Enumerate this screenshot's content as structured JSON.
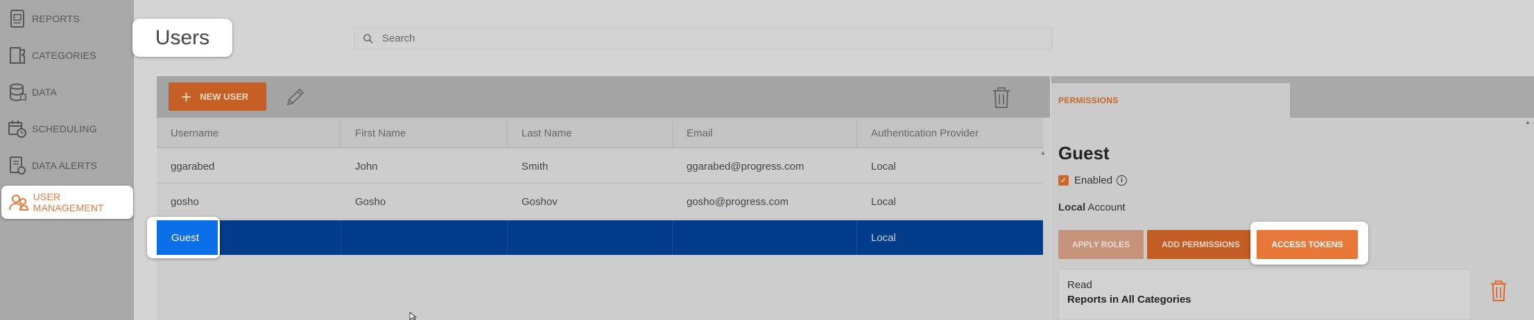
{
  "sidebar": {
    "items": [
      {
        "label": "REPORTS",
        "icon": "report-icon"
      },
      {
        "label": "CATEGORIES",
        "icon": "categories-icon"
      },
      {
        "label": "DATA",
        "icon": "database-icon"
      },
      {
        "label": "SCHEDULING",
        "icon": "scheduling-icon"
      },
      {
        "label": "DATA ALERTS",
        "icon": "alert-icon"
      },
      {
        "label": "USER MANAGEMENT",
        "icon": "users-icon",
        "active": true
      }
    ]
  },
  "page": {
    "title": "Users"
  },
  "search": {
    "placeholder": "Search",
    "icon": "search-icon"
  },
  "toolbar": {
    "new_user_label": "NEW USER",
    "new_user_icon": "plus-icon",
    "edit_icon": "pencil-icon",
    "delete_icon": "trash-icon"
  },
  "grid": {
    "columns": [
      "Username",
      "First Name",
      "Last Name",
      "Email",
      "Authentication Provider"
    ],
    "rows": [
      {
        "username": "ggarabed",
        "first": "John",
        "last": "Smith",
        "email": "ggarabed@progress.com",
        "provider": "Local"
      },
      {
        "username": "gosho",
        "first": "Gosho",
        "last": "Goshov",
        "email": "gosho@progress.com",
        "provider": "Local"
      },
      {
        "username": "Guest",
        "first": "",
        "last": "",
        "email": "",
        "provider": "Local",
        "selected": true
      }
    ]
  },
  "details": {
    "tab_label": "PERMISSIONS",
    "name": "Guest",
    "enabled_label": "Enabled",
    "enabled": true,
    "account_type": "Local",
    "account_suffix": " Account",
    "buttons": {
      "apply_roles": "APPLY ROLES",
      "add_permissions": "ADD PERMISSIONS",
      "access_tokens": "ACCESS TOKENS"
    },
    "permission": {
      "type": "Read",
      "scope": "Reports in All Categories"
    }
  },
  "colors": {
    "accent": "#e8773a",
    "selected_row": "#023c8a",
    "selected_cell": "#0b6fe8"
  }
}
